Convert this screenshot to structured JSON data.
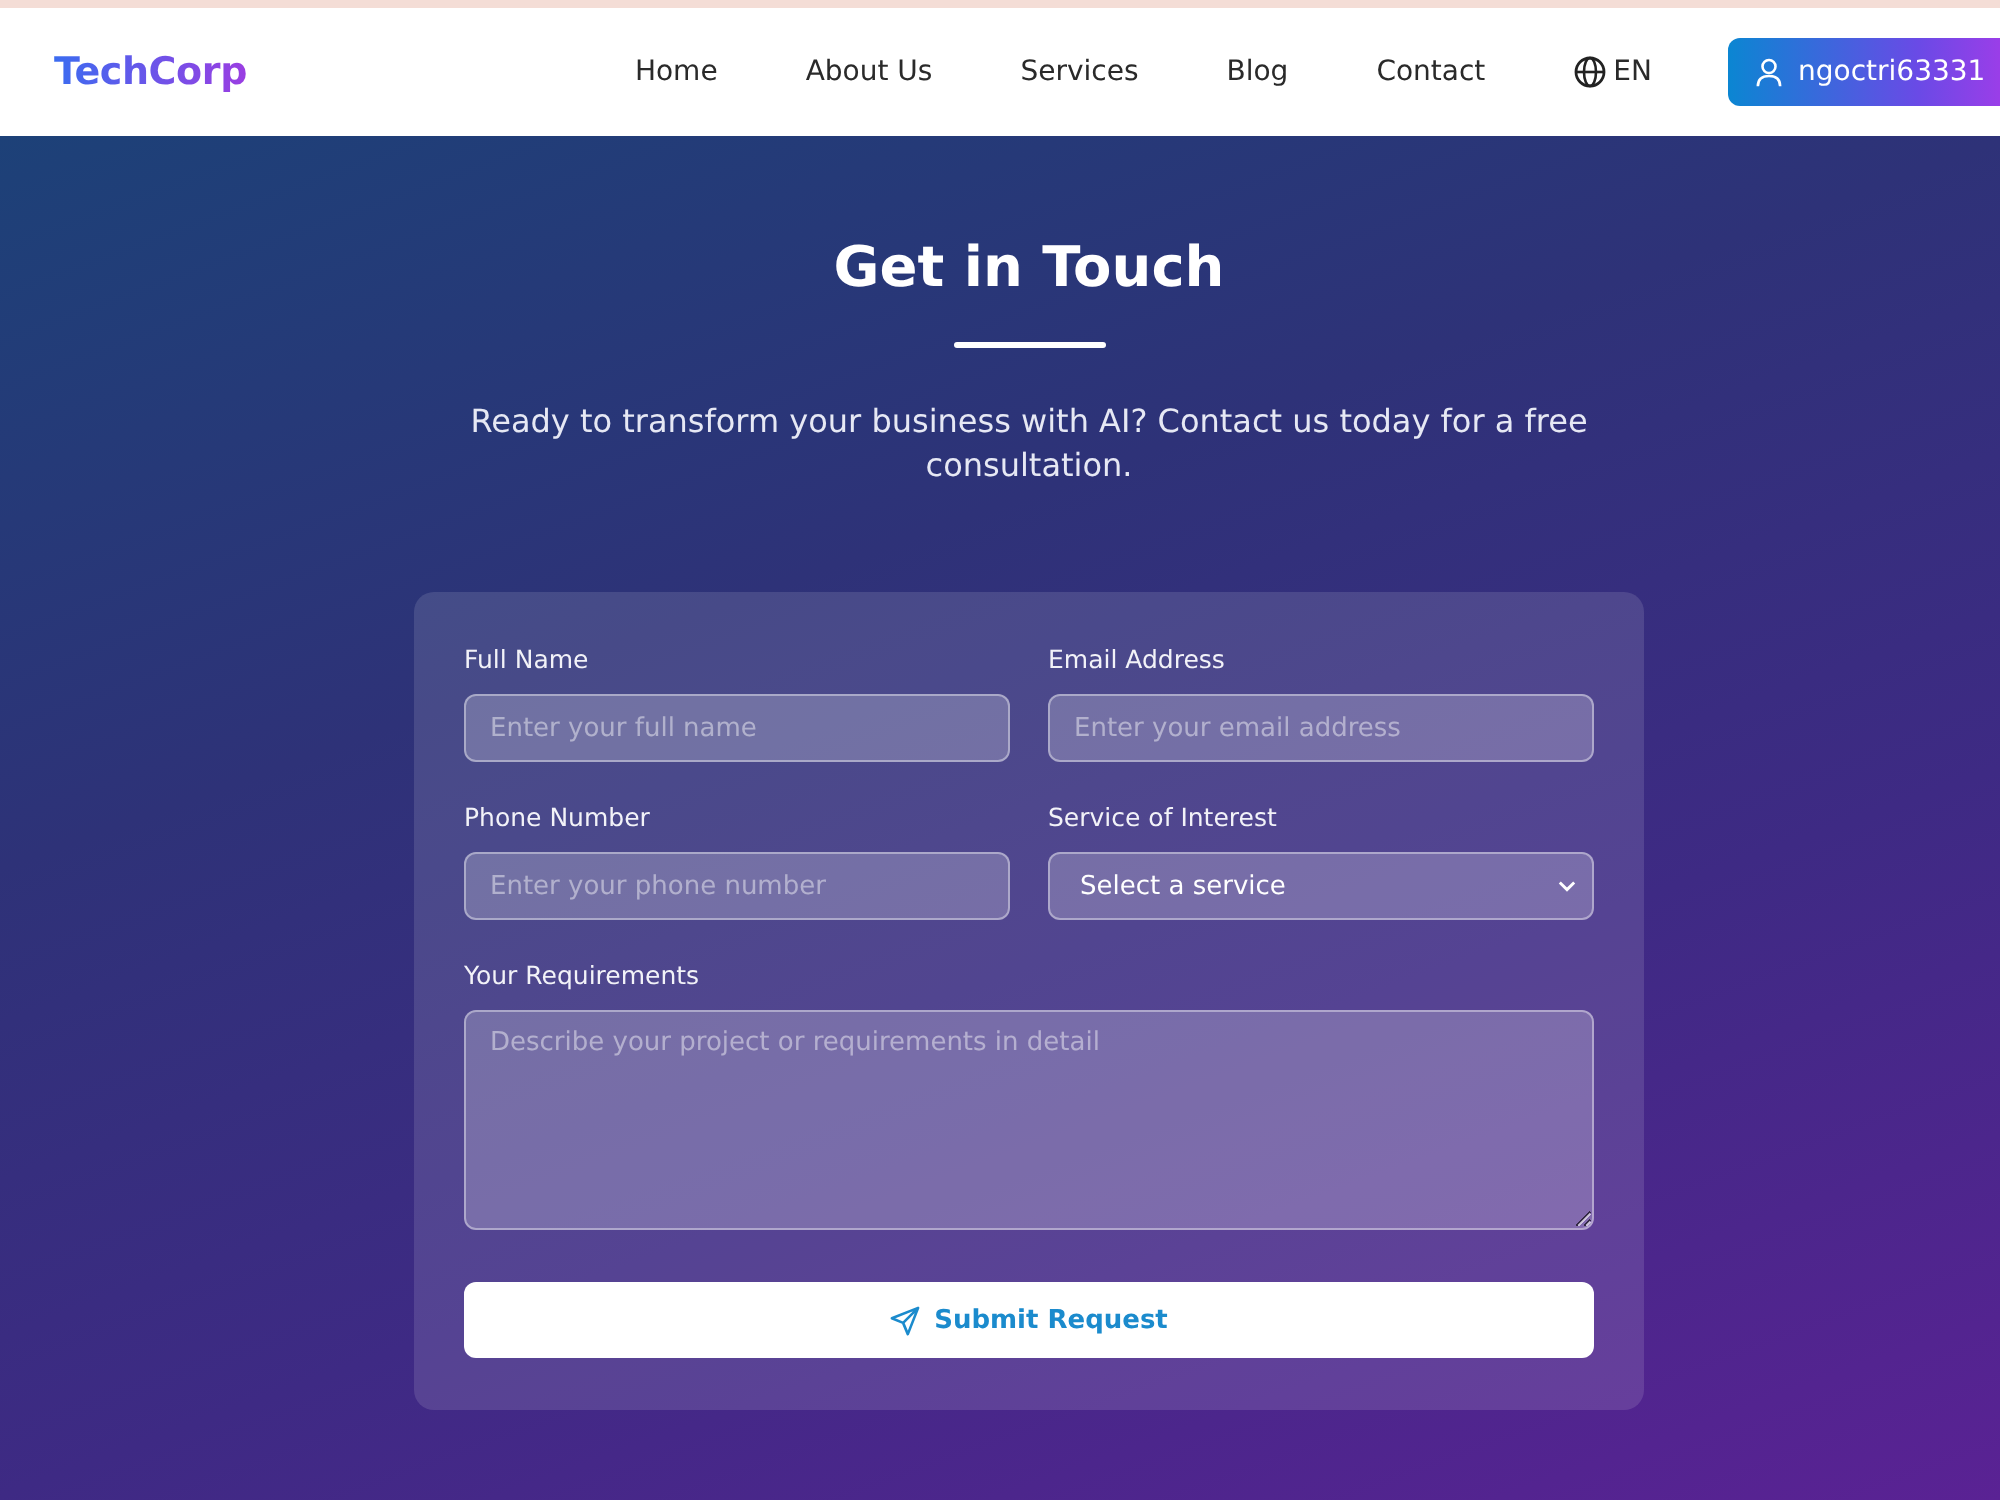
{
  "header": {
    "logo": "TechCorp",
    "nav": [
      {
        "label": "Home"
      },
      {
        "label": "About Us"
      },
      {
        "label": "Services"
      },
      {
        "label": "Blog"
      },
      {
        "label": "Contact"
      }
    ],
    "language": "EN",
    "user": "ngoctri63331"
  },
  "hero": {
    "title": "Get in Touch",
    "subtitle": "Ready to transform your business with AI? Contact us today for a free consultation."
  },
  "form": {
    "fields": [
      {
        "kind": "input",
        "label": "Full Name",
        "placeholder": "Enter your full name"
      },
      {
        "kind": "input",
        "label": "Email Address",
        "placeholder": "Enter your email address"
      },
      {
        "kind": "input",
        "label": "Phone Number",
        "placeholder": "Enter your phone number"
      },
      {
        "kind": "select",
        "label": "Service of Interest",
        "value": "Select a service"
      },
      {
        "kind": "textarea",
        "label": "Your Requirements",
        "placeholder": "Describe your project or requirements in detail"
      }
    ],
    "submit": "Submit Request"
  }
}
